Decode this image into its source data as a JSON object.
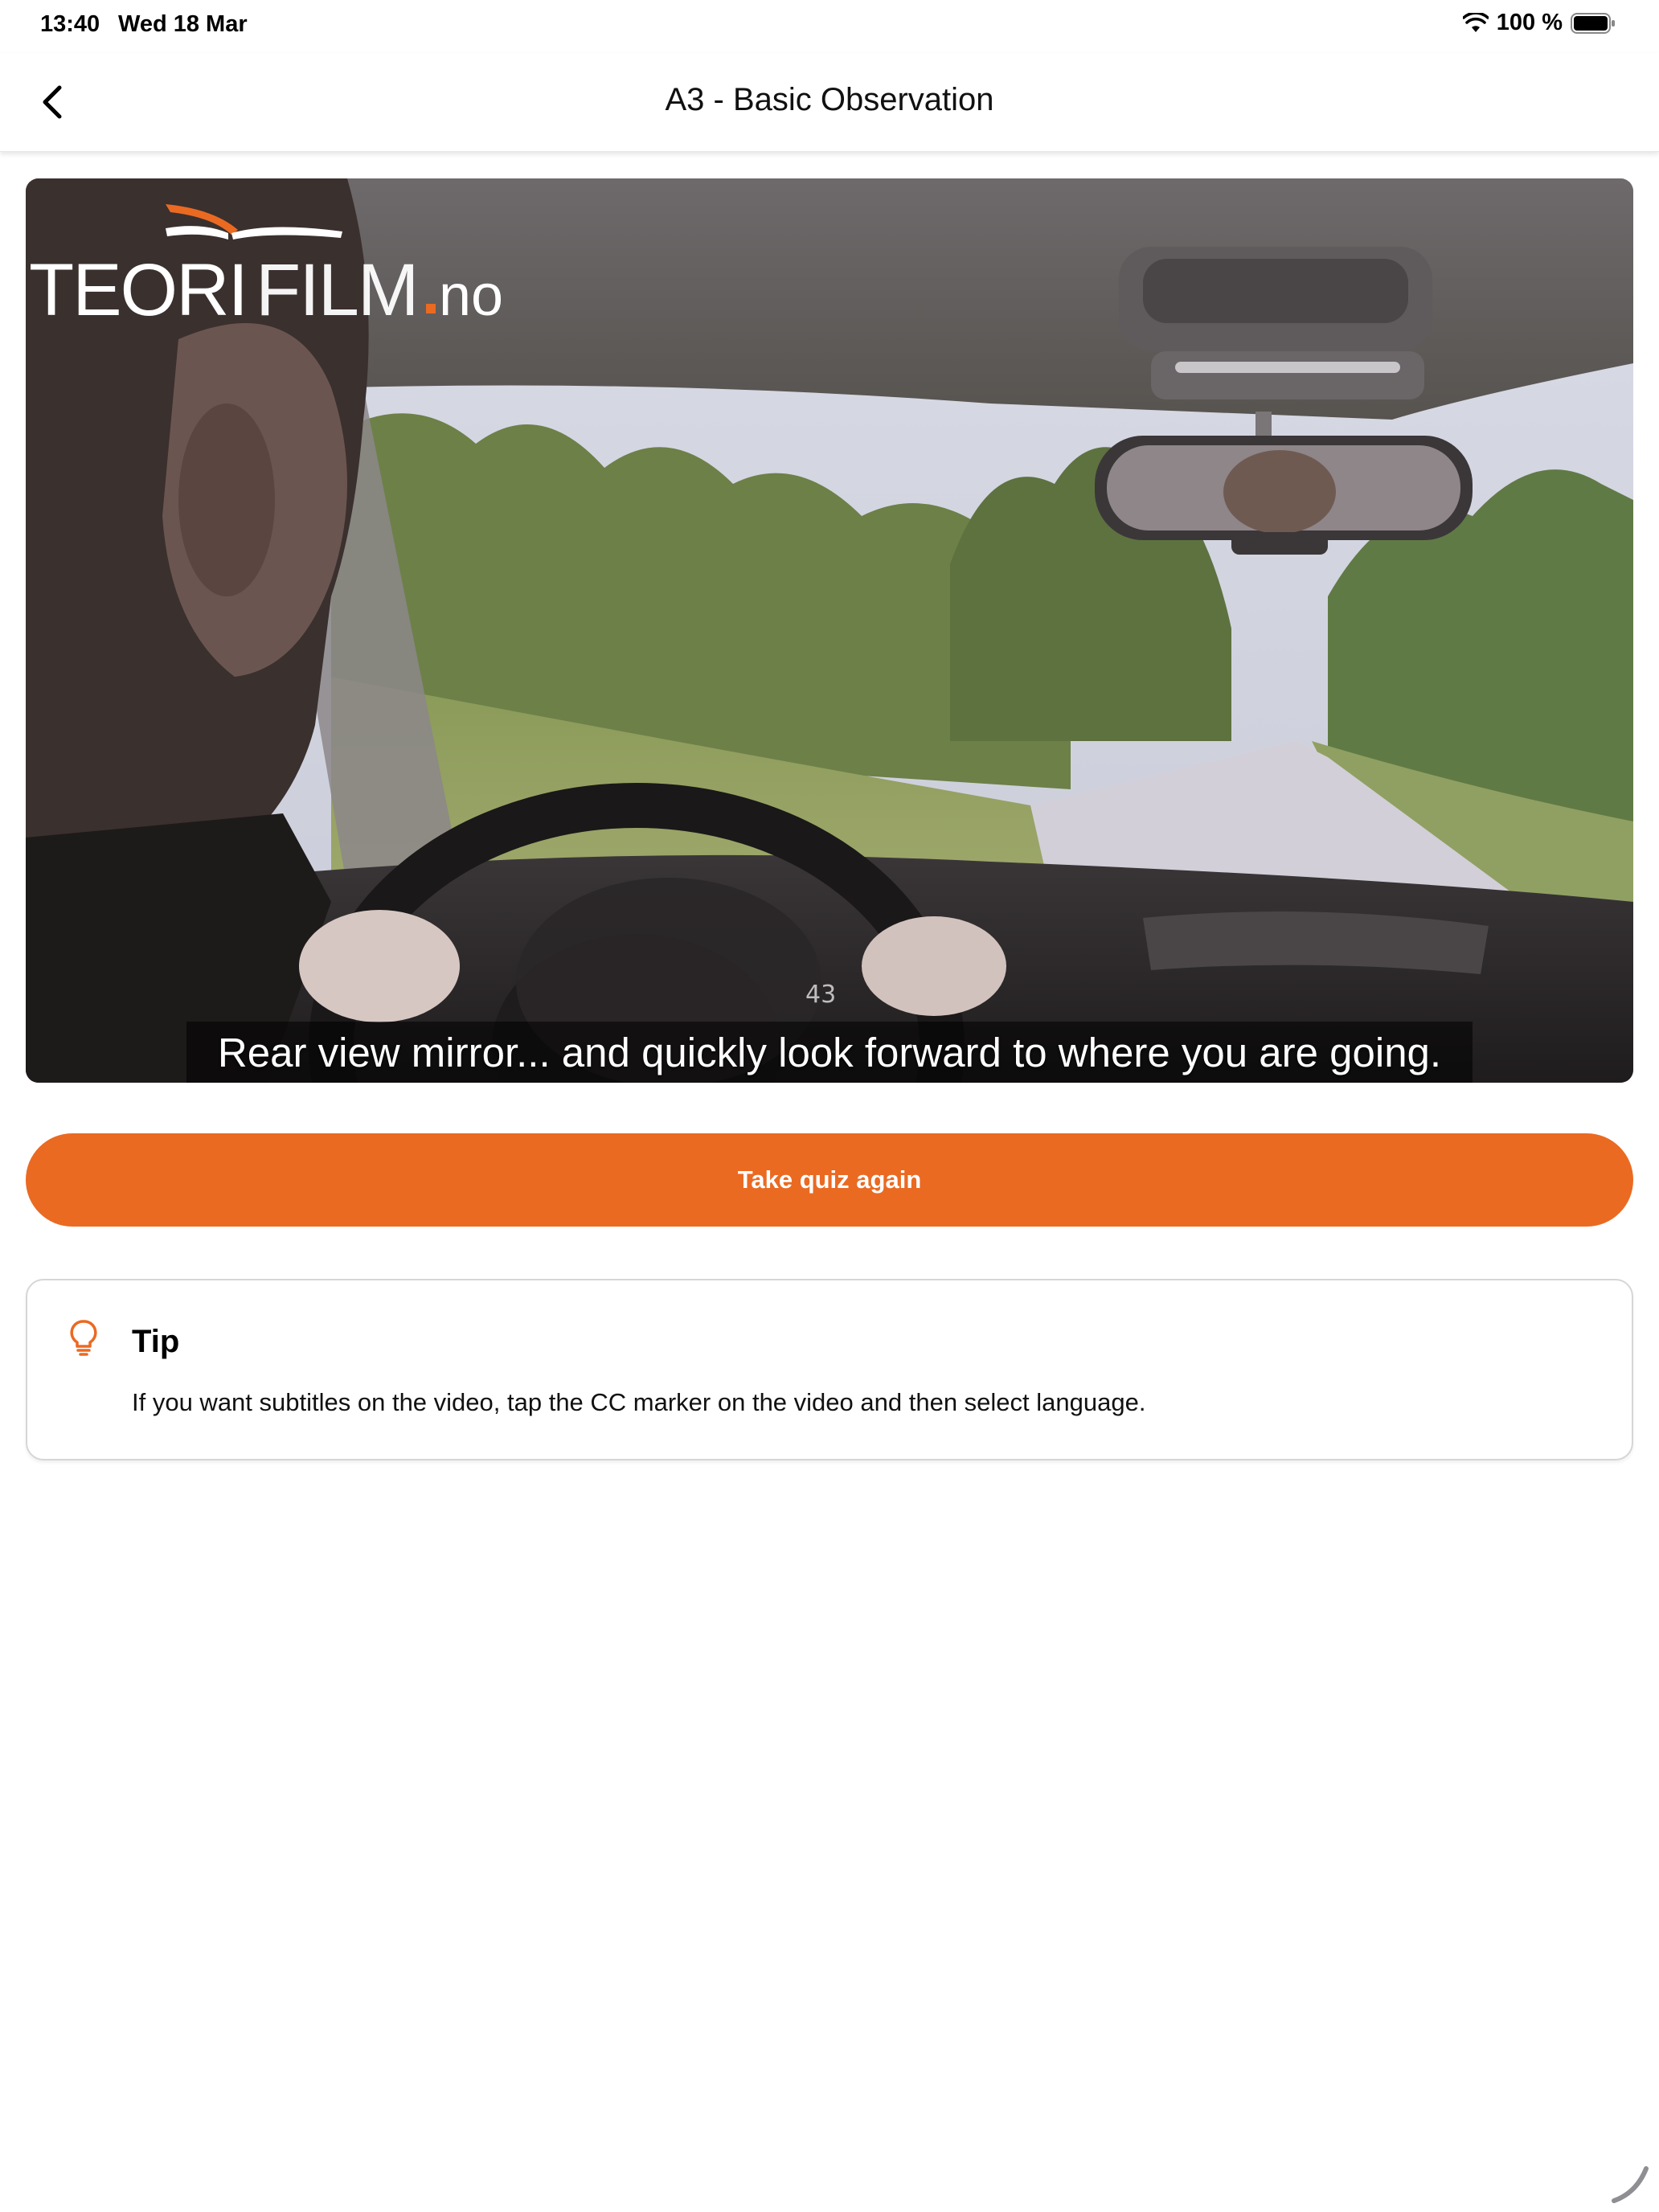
{
  "status_bar": {
    "time": "13:40",
    "date": "Wed 18 Mar",
    "battery": "100 %"
  },
  "nav": {
    "title": "A3 - Basic Observation"
  },
  "video": {
    "logo_text": "TEORIFILM.no",
    "subtitle": "Rear view mirror... and quickly look forward to where you are going."
  },
  "quiz_button": {
    "label": "Take quiz again"
  },
  "tip": {
    "title": "Tip",
    "text": "If you want subtitles on the video, tap the CC marker on the video and then select language."
  },
  "colors": {
    "accent": "#ea6a22",
    "background": "#ffffff",
    "card_border": "#d6d6d6"
  },
  "icons": [
    "chevron-left-icon",
    "wifi-icon",
    "battery-icon",
    "lightbulb-icon"
  ]
}
